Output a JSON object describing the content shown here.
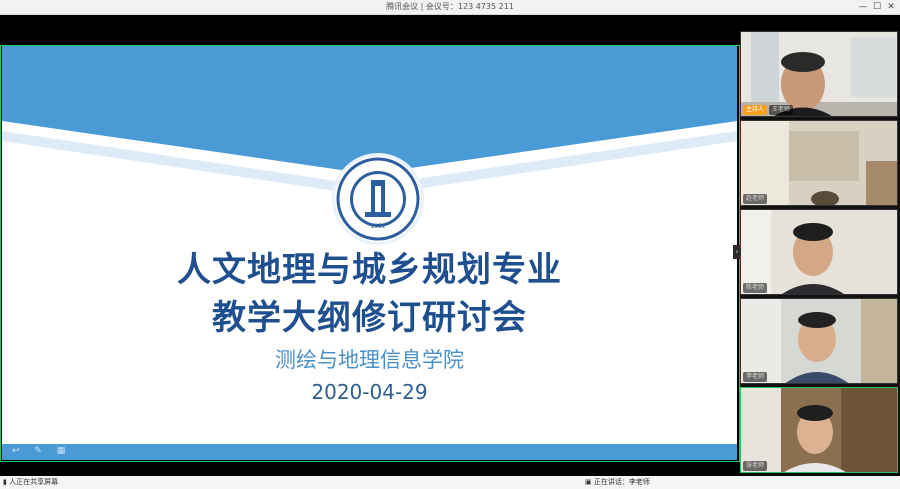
{
  "window": {
    "title": "腾讯会议 | 会议号：123 4735 211",
    "controls": [
      "—",
      "☐",
      "✕"
    ]
  },
  "slide": {
    "title_line1": "人文地理与城乡规划专业",
    "title_line2": "教学大纲修订研讨会",
    "subtitle": "测绘与地理信息学院",
    "date": "2020-04-29",
    "bottom_icons": "↩ ✎ ▦"
  },
  "participants": [
    {
      "name": "王老师",
      "tag": "主持人"
    },
    {
      "name": "赵老师"
    },
    {
      "name": "陈老师"
    },
    {
      "name": "李老师"
    },
    {
      "name": "张老师"
    }
  ],
  "footer": {
    "left_text": "▮ 人正在共享屏幕",
    "right_text": "▣ 正在讲话：李老师"
  },
  "colors": {
    "slide_blue": "#4a9ad6",
    "title_blue": "#1f4f8f",
    "active_border": "#22c55e"
  }
}
